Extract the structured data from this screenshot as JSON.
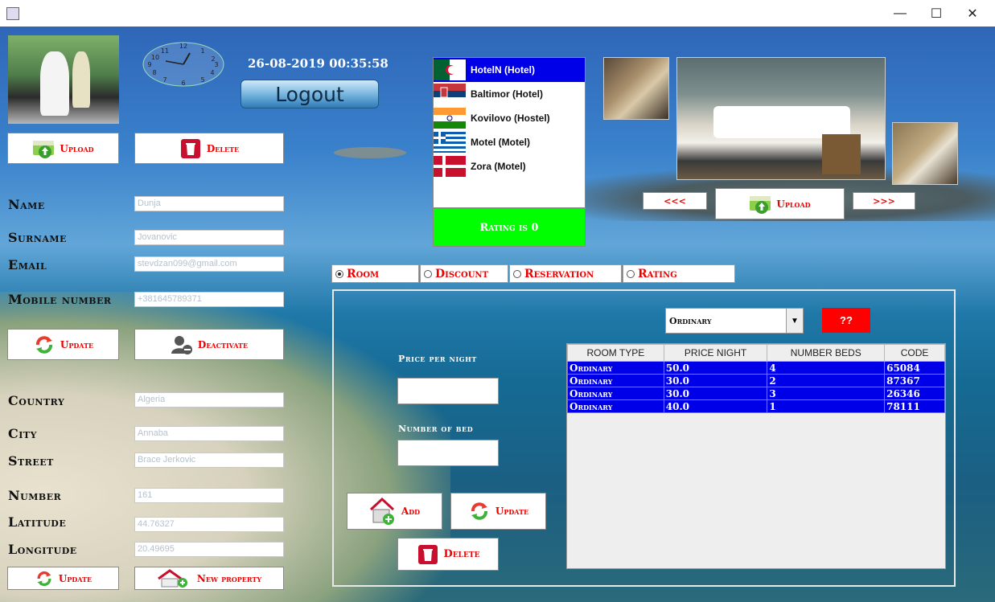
{
  "window": {
    "minimize": "—",
    "maximize": "☐",
    "close": "✕"
  },
  "profile": {
    "datetime": "26-08-2019 00:35:58",
    "logout": "Logout",
    "upload_label": "Upload",
    "delete_label": "Delete",
    "update_label": "Update",
    "deactivate_label": "Deactivate",
    "update2_label": "Update",
    "new_property_label": "New property"
  },
  "fields": {
    "name_label": "Name",
    "name": "Dunja",
    "surname_label": "Surname",
    "surname": "Jovanovic",
    "email_label": "Email",
    "email": "stevdzan099@gmail.com",
    "mobile_label": "Mobile number",
    "mobile": "+381645789371",
    "country_label": "Country",
    "country": "Algeria",
    "city_label": "City",
    "city": "Annaba",
    "street_label": "Street",
    "street": "Brace Jerkovic",
    "number_label": "Number",
    "number": "161",
    "latitude_label": "Latitude",
    "latitude": "44.76327",
    "longitude_label": "Longitude",
    "longitude": "20.49695"
  },
  "properties": {
    "items": [
      {
        "label": "HotelN (Hotel)",
        "flag": "algeria-flag-icon"
      },
      {
        "label": "Baltimor (Hotel)",
        "flag": "serbia-flag-icon"
      },
      {
        "label": "Kovilovo (Hostel)",
        "flag": "india-flag-icon"
      },
      {
        "label": "Motel (Motel)",
        "flag": "greece-flag-icon"
      },
      {
        "label": "Zora (Motel)",
        "flag": "denmark-flag-icon"
      }
    ],
    "selected_index": 0,
    "rating_text": "Rating is 0"
  },
  "gallery": {
    "prev": "<<<",
    "next": ">>>",
    "upload_label": "Upload"
  },
  "tabs": [
    {
      "label": "Room",
      "selected": true
    },
    {
      "label": "Discount",
      "selected": false
    },
    {
      "label": "Reservation",
      "selected": false
    },
    {
      "label": "Rating",
      "selected": false
    }
  ],
  "room_panel": {
    "room_type_select": "Ordinary",
    "help_button": "??",
    "price_label": "Price per night",
    "beds_label": "Number of bed",
    "add_label": "Add",
    "update_label": "Update",
    "delete_label": "Delete",
    "table": {
      "headers": [
        "ROOM TYPE",
        "PRICE NIGHT",
        "NUMBER BEDS",
        "CODE"
      ],
      "rows": [
        [
          "Ordinary",
          "50.0",
          "4",
          "65084"
        ],
        [
          "Ordinary",
          "30.0",
          "2",
          "87367"
        ],
        [
          "Ordinary",
          "30.0",
          "3",
          "26346"
        ],
        [
          "Ordinary",
          "40.0",
          "1",
          "78111"
        ]
      ]
    }
  },
  "colors": {
    "accent_red": "#ee0000",
    "selection_blue": "#0000e8",
    "rating_green": "#00ff00"
  }
}
